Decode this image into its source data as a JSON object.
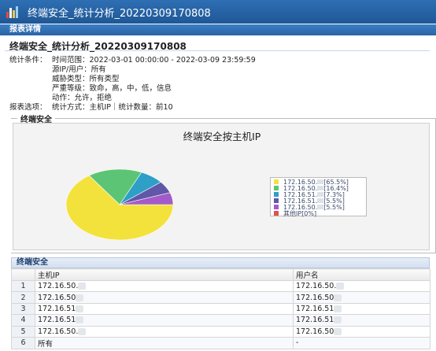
{
  "window": {
    "title": "终端安全_统计分析_20220309170808"
  },
  "panel": {
    "section_label": "报表详情"
  },
  "report": {
    "title": "终端安全_统计分析_20220309170808",
    "conditions_label": "统计条件：",
    "time_range": "时间范围：2022-03-01 00:00:00 - 2022-03-09 23:59:59",
    "source_ip": "源IP/用户：所有",
    "threat_type": "威胁类型：所有类型",
    "severity": "严重等级：致命，高，中，低，信息",
    "action": "动作：允许，拒绝",
    "options_label": "报表选项：",
    "options": "统计方式：主机IP｜统计数量：前10"
  },
  "chart_section": {
    "legend": "终端安全"
  },
  "chart_data": {
    "type": "pie",
    "title": "终端安全按主机IP",
    "slices": [
      {
        "label": "172.16.50.",
        "pct_text": "[65.5%]",
        "value": 65.5,
        "color": "#f4e23c"
      },
      {
        "label": "172.16.50.",
        "pct_text": "[16.4%]",
        "value": 16.4,
        "color": "#5cc575"
      },
      {
        "label": "172.16.51.",
        "pct_text": "[7.3%]",
        "value": 7.3,
        "color": "#2e9fc6"
      },
      {
        "label": "172.16.51.",
        "pct_text": "[5.5%]",
        "value": 5.5,
        "color": "#6157a8"
      },
      {
        "label": "172.16.50.",
        "pct_text": "[5.5%]",
        "value": 5.5,
        "color": "#a35bc9"
      },
      {
        "label": "其他IP",
        "pct_text": "[0%]",
        "value": 0,
        "color": "#e0524b"
      }
    ],
    "legend_position": "right"
  },
  "table": {
    "title": "终端安全",
    "columns": [
      "主机IP",
      "用户名"
    ],
    "rows": [
      {
        "num": "1",
        "ip": "172.16.50.",
        "user": "172.16.50."
      },
      {
        "num": "2",
        "ip": "172.16.50",
        "user": "172.16.50"
      },
      {
        "num": "3",
        "ip": "172.16.51",
        "user": "172.16.51"
      },
      {
        "num": "4",
        "ip": "172.16.51",
        "user": "172.16.51"
      },
      {
        "num": "5",
        "ip": "172.16.50.",
        "user": "172.16.50"
      },
      {
        "num": "6",
        "ip": "所有",
        "user": "-"
      }
    ]
  }
}
